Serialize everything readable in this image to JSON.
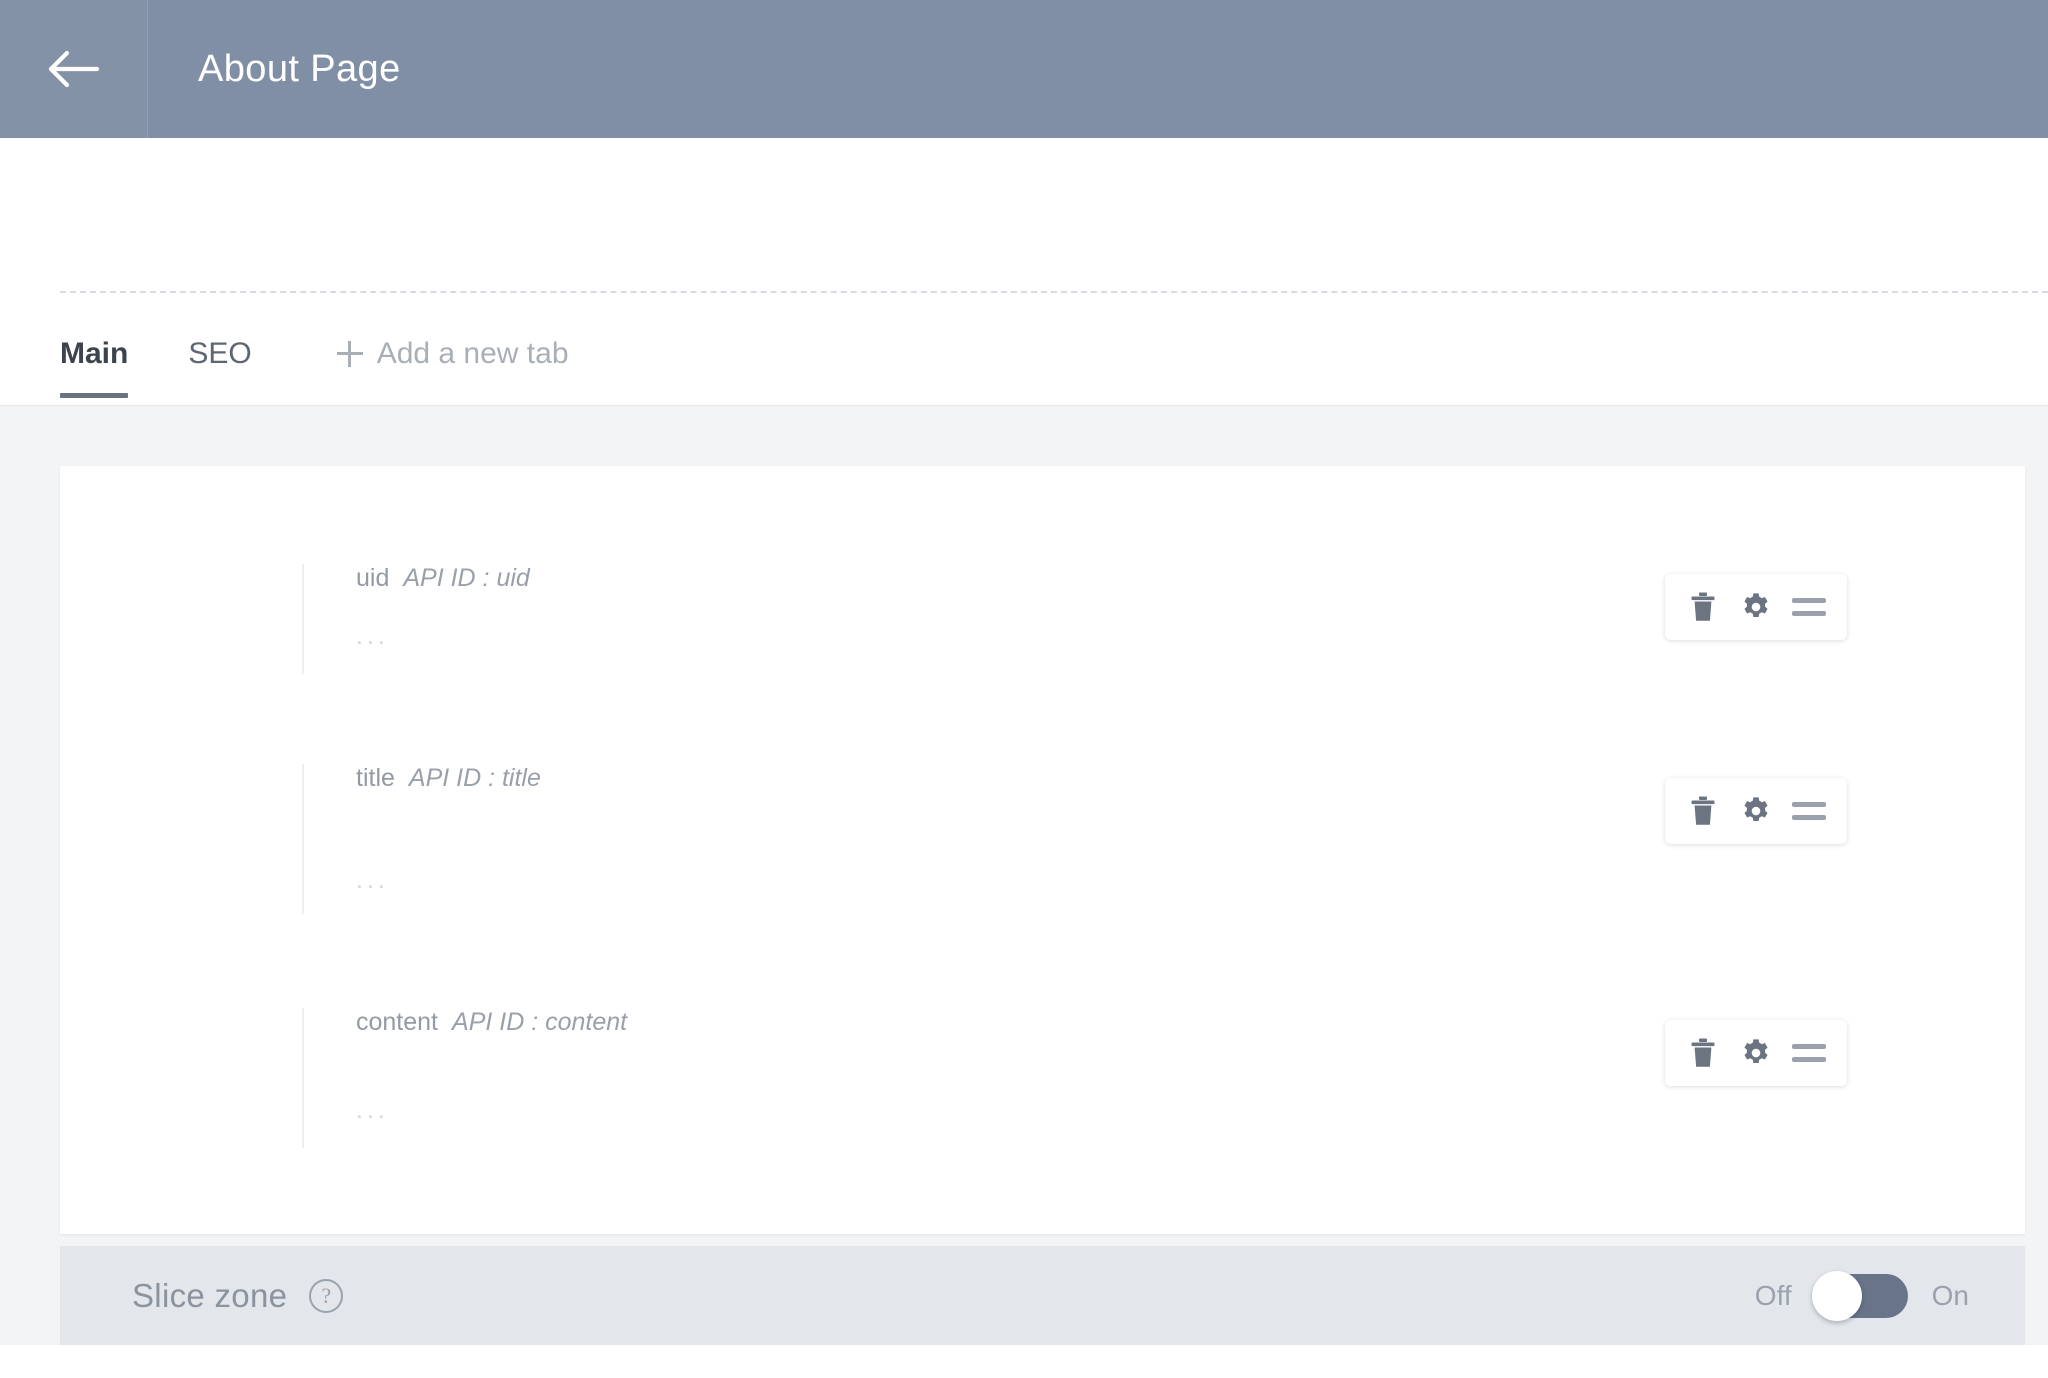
{
  "header": {
    "back_icon": "arrow-left-icon",
    "title": "About Page"
  },
  "tabs": {
    "items": [
      {
        "label": "Main",
        "active": true
      },
      {
        "label": "SEO",
        "active": false
      }
    ],
    "add_tab_label": "Add a new tab",
    "add_tab_icon": "plus-icon"
  },
  "fields": [
    {
      "name": "uid",
      "api_id_label": "API ID : uid",
      "placeholder": "...",
      "actions": {
        "delete_icon": "trash-icon",
        "settings_icon": "gear-icon",
        "drag_icon": "drag-handle-icon"
      }
    },
    {
      "name": "title",
      "api_id_label": "API ID : title",
      "placeholder": "...",
      "actions": {
        "delete_icon": "trash-icon",
        "settings_icon": "gear-icon",
        "drag_icon": "drag-handle-icon"
      }
    },
    {
      "name": "content",
      "api_id_label": "API ID : content",
      "placeholder": "...",
      "actions": {
        "delete_icon": "trash-icon",
        "settings_icon": "gear-icon",
        "drag_icon": "drag-handle-icon"
      }
    }
  ],
  "slice_zone": {
    "title": "Slice zone",
    "help_icon": "question-mark-icon",
    "help_glyph": "?",
    "toggle": {
      "off_label": "Off",
      "on_label": "On",
      "state": "off"
    }
  },
  "colors": {
    "header_bg": "#818fa6",
    "page_bg": "#f3f4f6",
    "card_bg": "#ffffff",
    "slice_zone_bg": "#e3e7eb",
    "active_tab_underline": "#6b7280",
    "icon_gray": "#6b7480",
    "muted_text": "#9aa0aa",
    "toggle_track": "#69748a"
  }
}
